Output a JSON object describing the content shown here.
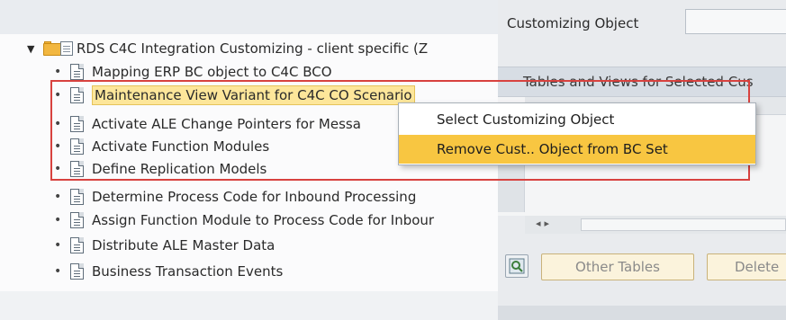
{
  "tree": {
    "root_label": "RDS C4C Integration Customizing - client specific (Z",
    "items": [
      {
        "label": "Mapping ERP BC object to C4C BCO"
      },
      {
        "label": "Maintenance View Variant for C4C CO Scenario"
      },
      {
        "label": "Activate ALE Change Pointers for Messa"
      },
      {
        "label": "Activate Function Modules"
      },
      {
        "label": "Define Replication Models"
      },
      {
        "label": "Determine Process Code for Inbound Processing"
      },
      {
        "label": "Assign Function Module to Process Code for Inbour"
      },
      {
        "label": "Distribute ALE Master Data"
      },
      {
        "label": "Business Transaction Events"
      }
    ]
  },
  "right_panel": {
    "customizing_object_label": "Customizing Object",
    "customizing_object_value": "",
    "section_title": "Tables and Views for Selected Cus",
    "other_tables_button": "Other Tables",
    "delete_button": "Delete"
  },
  "context_menu": {
    "items": [
      {
        "label": "Select Customizing Object"
      },
      {
        "label": "Remove Cust.. Object from BC Set"
      }
    ]
  },
  "colors": {
    "highlight_red": "#d8423f",
    "menu_highlight": "#f8c641",
    "selection_yellow": "#fde69a"
  }
}
